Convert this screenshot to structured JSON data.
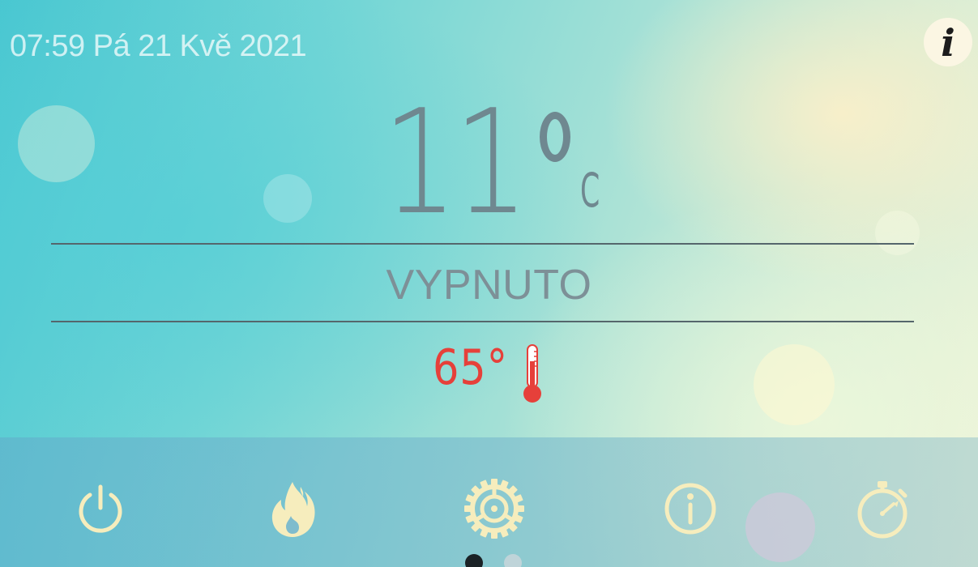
{
  "header": {
    "datetime": "07:59 Pá 21 Kvě 2021",
    "info_icon": "info-icon"
  },
  "temperature": {
    "value": "11",
    "unit": "C"
  },
  "status": {
    "label": "VYPNUTO"
  },
  "water": {
    "value": "65°",
    "icon": "thermometer-icon"
  },
  "nav": {
    "items": [
      {
        "icon": "power-icon"
      },
      {
        "icon": "flame-icon"
      },
      {
        "icon": "gear-icon"
      },
      {
        "icon": "info-circle-icon"
      },
      {
        "icon": "stopwatch-icon"
      }
    ]
  },
  "pagination": {
    "active_page": 1,
    "total_pages": 2
  },
  "colors": {
    "icon": "#f6edbd",
    "temperature": "#6f8890",
    "status": "#7d9097",
    "water": "#e6403a"
  }
}
